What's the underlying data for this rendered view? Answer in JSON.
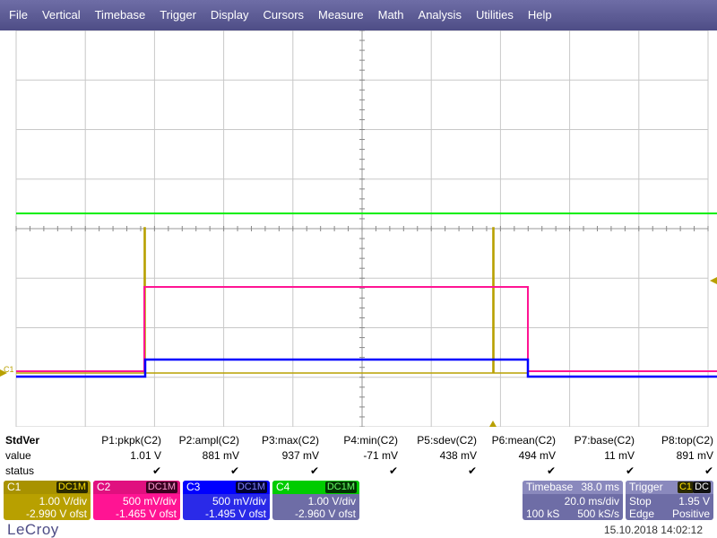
{
  "menu": [
    "File",
    "Vertical",
    "Timebase",
    "Trigger",
    "Display",
    "Cursors",
    "Measure",
    "Math",
    "Analysis",
    "Utilities",
    "Help"
  ],
  "colors": {
    "c1": "#b8a000",
    "c2": "#ff1493",
    "c3": "#0000ff",
    "c4": "#00ee00",
    "grid": "#c8c8c8",
    "menu": "#5d5c95"
  },
  "grid_ref_label": "C1",
  "measurements": {
    "title": "StdVer",
    "row_labels": [
      "value",
      "status"
    ],
    "params": [
      {
        "name": "P1:pkpk(C2)",
        "value": "1.01 V",
        "status": "✔"
      },
      {
        "name": "P2:ampl(C2)",
        "value": "881 mV",
        "status": "✔"
      },
      {
        "name": "P3:max(C2)",
        "value": "937 mV",
        "status": "✔"
      },
      {
        "name": "P4:min(C2)",
        "value": "-71 mV",
        "status": "✔"
      },
      {
        "name": "P5:sdev(C2)",
        "value": "438 mV",
        "status": "✔"
      },
      {
        "name": "P6:mean(C2)",
        "value": "494 mV",
        "status": "✔"
      },
      {
        "name": "P7:base(C2)",
        "value": "11 mV",
        "status": "✔"
      },
      {
        "name": "P8:top(C2)",
        "value": "891 mV",
        "status": "✔"
      }
    ]
  },
  "channels": [
    {
      "name": "C1",
      "coupling": "DC1M",
      "vdiv": "1.00 V/div",
      "offset": "-2.990 V ofst",
      "color": "#b8a000"
    },
    {
      "name": "C2",
      "coupling": "DC1M",
      "vdiv": "500 mV/div",
      "offset": "-1.465 V ofst",
      "color": "#ff1493"
    },
    {
      "name": "C3",
      "coupling": "DC1M",
      "vdiv": "500 mV/div",
      "offset": "-1.495 V ofst",
      "color": "#0000ff"
    },
    {
      "name": "C4",
      "coupling": "DC1M",
      "vdiv": "1.00 V/div",
      "offset": "-2.960 V ofst",
      "color": "#00ee00"
    }
  ],
  "timebase": {
    "label": "Timebase",
    "delay": "38.0 ms",
    "tdiv": "20.0 ms/div",
    "samples": "100 kS",
    "rate": "500 kS/s"
  },
  "trigger": {
    "label": "Trigger",
    "channel": "C1",
    "coupling": "DC",
    "mode": "Stop",
    "level": "1.95 V",
    "type": "Edge",
    "slope": "Positive"
  },
  "brand": "LeCroy",
  "datetime": "15.10.2018 14:02:12"
}
